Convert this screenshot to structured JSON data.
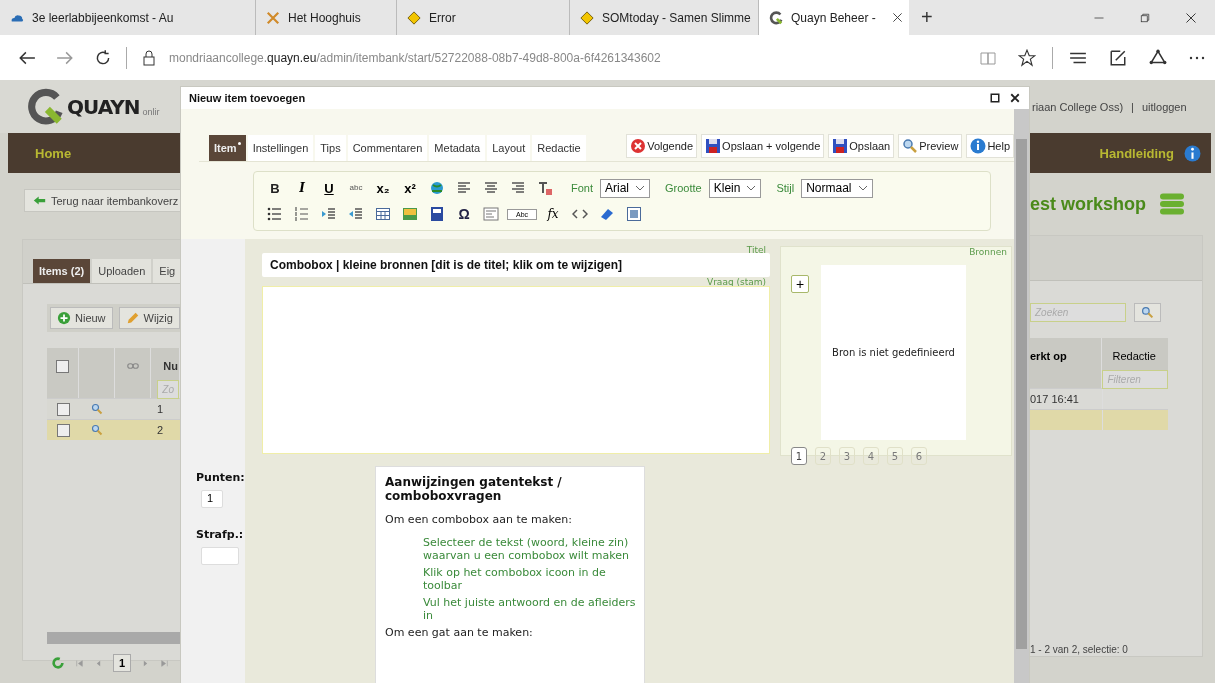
{
  "browser": {
    "tabs": [
      {
        "kind": "cloud",
        "title": "3e leerlabbijeenkomst - Au",
        "selected": false
      },
      {
        "kind": "tools",
        "title": "Het Hooghuis",
        "selected": false
      },
      {
        "kind": "diamond",
        "title": "Error",
        "selected": false
      },
      {
        "kind": "diamond",
        "title": "SOMtoday - Samen Slimme",
        "selected": false
      },
      {
        "kind": "ring",
        "title": "Quayn Beheer -",
        "selected": true
      }
    ],
    "new_tab": "+",
    "url": "mondriaancollege.**quayn.eu**/admin/itembank/start/52722088-08b7-49d8-800a-6f4261343602"
  },
  "site": {
    "logo": "QUAYN",
    "logo_tagline": "onlir",
    "account": "riaan College Oss)",
    "separator": "|",
    "logout": "uitloggen",
    "nav": {
      "home": "Home",
      "manual": "Handleiding"
    },
    "back_button": "Terug naar itembankoverz",
    "itembank_title": "est workshop",
    "tabs": [
      {
        "label": "Items (2)",
        "selected": true
      },
      {
        "label": "Uploaden",
        "selected": false
      },
      {
        "label": "Eig",
        "selected": false
      }
    ],
    "toolbar": [
      {
        "kind": "add",
        "label": "Nieuw"
      },
      {
        "kind": "edit",
        "label": "Wijzig"
      }
    ],
    "search": {
      "placeholder": "Zoeken"
    },
    "table": {
      "select_all": {
        "checked": false
      },
      "columns": [
        {
          "label": "Nu",
          "filter_placeholder": "Zo"
        },
        {
          "label": "erkt op"
        },
        {
          "label": "Redactie",
          "filter_placeholder": "Filteren"
        }
      ],
      "rows": [
        {
          "checked": false,
          "selected": false,
          "cells": [
            "1",
            "017 16:41"
          ]
        },
        {
          "checked": false,
          "selected": true,
          "cells": [
            "2"
          ]
        }
      ]
    },
    "pager": {
      "page": "1",
      "summary": "1 - 2 van 2, selectie: 0"
    }
  },
  "dialog": {
    "title": "Nieuw item toevoegen",
    "tabs": [
      {
        "label": "Item",
        "selected": true,
        "modified": true
      },
      {
        "label": "Instellingen",
        "selected": false,
        "modified": false
      },
      {
        "label": "Tips",
        "selected": false,
        "modified": false
      },
      {
        "label": "Commentaren",
        "selected": false,
        "modified": false
      },
      {
        "label": "Metadata",
        "selected": false,
        "modified": false
      },
      {
        "label": "Layout",
        "selected": false,
        "modified": false
      },
      {
        "label": "Redactie",
        "selected": false,
        "modified": false
      }
    ],
    "actions": [
      {
        "kind": "cancel",
        "label": "Volgende"
      },
      {
        "kind": "save",
        "label": "Opslaan + volgende"
      },
      {
        "kind": "save",
        "label": "Opslaan"
      },
      {
        "kind": "preview",
        "label": "Preview"
      },
      {
        "kind": "help",
        "label": "Help"
      }
    ],
    "toolbar": {
      "rows": [
        [
          {
            "kind": "bold",
            "text": "B"
          },
          {
            "kind": "italic",
            "text": "I"
          },
          {
            "kind": "underline",
            "text": "U"
          },
          {
            "kind": "strike",
            "text": "abc"
          },
          {
            "kind": "sub",
            "text": "x₂"
          },
          {
            "kind": "sup",
            "text": "x²"
          },
          {
            "kind": "globe"
          },
          {
            "kind": "align-left"
          },
          {
            "kind": "align-center"
          },
          {
            "kind": "align-right"
          },
          {
            "kind": "clear-format"
          }
        ],
        [
          {
            "kind": "bullet-list"
          },
          {
            "kind": "numbered-list"
          },
          {
            "kind": "indent"
          },
          {
            "kind": "outdent"
          },
          {
            "kind": "table"
          },
          {
            "kind": "image"
          },
          {
            "kind": "media"
          },
          {
            "kind": "symbol",
            "text": "Ω"
          },
          {
            "kind": "template"
          },
          {
            "kind": "field",
            "text": "Abc"
          },
          {
            "kind": "formula",
            "text": "fx"
          },
          {
            "kind": "code"
          },
          {
            "kind": "eraser"
          },
          {
            "kind": "frame"
          }
        ]
      ],
      "selects": [
        {
          "label": "Font",
          "value": "Arial"
        },
        {
          "label": "Grootte",
          "value": "Klein"
        },
        {
          "label": "Stijl",
          "value": "Normaal"
        }
      ]
    },
    "score": {
      "label": "Punten:",
      "value": "1"
    },
    "penalty": {
      "label": "Strafp.:"
    },
    "question": {
      "title_label": "Titel",
      "title": "Combobox | kleine bronnen [dit is de titel; klik om te wijzigen]",
      "stem_label": "Vraag (stam)"
    },
    "sources": {
      "label": "Bronnen",
      "add": "+",
      "empty": "Bron is niet gedefinieerd",
      "pages": [
        {
          "label": "1",
          "selected": true
        },
        {
          "label": "2",
          "selected": false
        },
        {
          "label": "3",
          "selected": false
        },
        {
          "label": "4",
          "selected": false
        },
        {
          "label": "5",
          "selected": false
        },
        {
          "label": "6",
          "selected": false
        }
      ]
    },
    "hint": {
      "title": "Aanwijzingen gatentekst / comboboxvragen",
      "sections": [
        {
          "intro": "Om een combobox aan te maken:",
          "steps": [
            "Selecteer de tekst (woord, kleine zin) waarvan u een combobox wilt maken",
            "Klik op het combobox icoon in de toolbar",
            "Vul het juiste antwoord en de afleiders in"
          ]
        },
        {
          "intro": "Om een gat aan te maken:"
        }
      ]
    }
  }
}
